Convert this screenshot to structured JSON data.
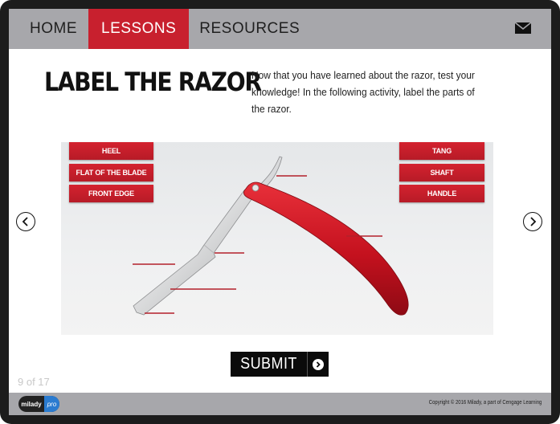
{
  "nav": {
    "items": [
      {
        "label": "HOME",
        "active": false
      },
      {
        "label": "LESSONS",
        "active": true
      },
      {
        "label": "RESOURCES",
        "active": false
      }
    ],
    "mail_icon": "envelope-icon"
  },
  "header": {
    "title": "LABEL THE RAZOR",
    "intro": "Now that you have learned about the razor, test your knowledge! In the following activity, label the parts of the razor."
  },
  "activity": {
    "labels_left": [
      "HEEL",
      "FLAT OF THE BLADE",
      "FRONT EDGE"
    ],
    "labels_right": [
      "TANG",
      "SHAFT",
      "HANDLE"
    ],
    "label_color": "#c8202e"
  },
  "navigation": {
    "prev_icon": "chevron-left-icon",
    "next_icon": "chevron-right-icon"
  },
  "submit": {
    "label": "SUBMIT",
    "icon": "chevron-right-circle-icon"
  },
  "page_counter": "9 of 17",
  "footer": {
    "logo_left": "milady",
    "logo_right": "pro",
    "copyright": "Copyright © 2016 Milady, a part of Cengage Learning"
  },
  "colors": {
    "accent": "#c8202e",
    "nav_bg": "#a7a7ab",
    "frame": "#1c1c1c"
  }
}
